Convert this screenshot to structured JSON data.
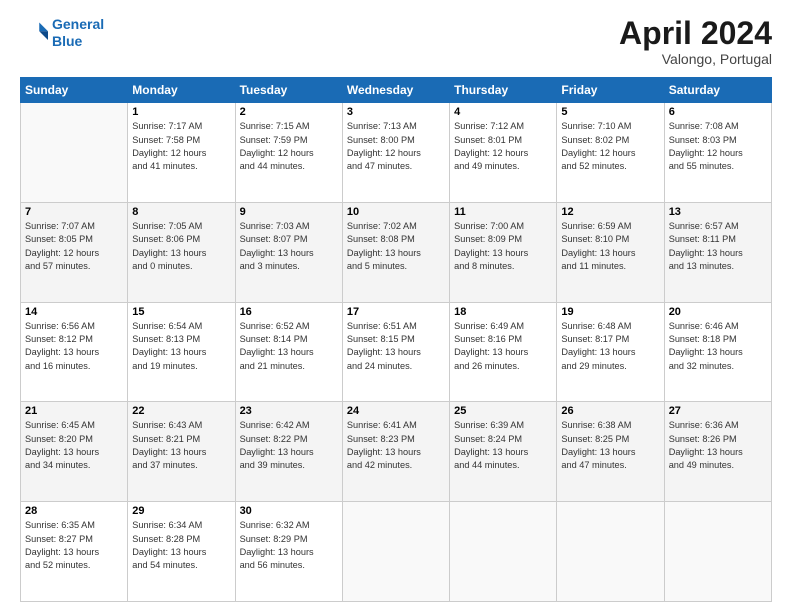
{
  "header": {
    "logo_line1": "General",
    "logo_line2": "Blue",
    "month_title": "April 2024",
    "location": "Valongo, Portugal"
  },
  "days_of_week": [
    "Sunday",
    "Monday",
    "Tuesday",
    "Wednesday",
    "Thursday",
    "Friday",
    "Saturday"
  ],
  "weeks": [
    [
      {
        "day": "",
        "info": ""
      },
      {
        "day": "1",
        "info": "Sunrise: 7:17 AM\nSunset: 7:58 PM\nDaylight: 12 hours\nand 41 minutes."
      },
      {
        "day": "2",
        "info": "Sunrise: 7:15 AM\nSunset: 7:59 PM\nDaylight: 12 hours\nand 44 minutes."
      },
      {
        "day": "3",
        "info": "Sunrise: 7:13 AM\nSunset: 8:00 PM\nDaylight: 12 hours\nand 47 minutes."
      },
      {
        "day": "4",
        "info": "Sunrise: 7:12 AM\nSunset: 8:01 PM\nDaylight: 12 hours\nand 49 minutes."
      },
      {
        "day": "5",
        "info": "Sunrise: 7:10 AM\nSunset: 8:02 PM\nDaylight: 12 hours\nand 52 minutes."
      },
      {
        "day": "6",
        "info": "Sunrise: 7:08 AM\nSunset: 8:03 PM\nDaylight: 12 hours\nand 55 minutes."
      }
    ],
    [
      {
        "day": "7",
        "info": "Sunrise: 7:07 AM\nSunset: 8:05 PM\nDaylight: 12 hours\nand 57 minutes."
      },
      {
        "day": "8",
        "info": "Sunrise: 7:05 AM\nSunset: 8:06 PM\nDaylight: 13 hours\nand 0 minutes."
      },
      {
        "day": "9",
        "info": "Sunrise: 7:03 AM\nSunset: 8:07 PM\nDaylight: 13 hours\nand 3 minutes."
      },
      {
        "day": "10",
        "info": "Sunrise: 7:02 AM\nSunset: 8:08 PM\nDaylight: 13 hours\nand 5 minutes."
      },
      {
        "day": "11",
        "info": "Sunrise: 7:00 AM\nSunset: 8:09 PM\nDaylight: 13 hours\nand 8 minutes."
      },
      {
        "day": "12",
        "info": "Sunrise: 6:59 AM\nSunset: 8:10 PM\nDaylight: 13 hours\nand 11 minutes."
      },
      {
        "day": "13",
        "info": "Sunrise: 6:57 AM\nSunset: 8:11 PM\nDaylight: 13 hours\nand 13 minutes."
      }
    ],
    [
      {
        "day": "14",
        "info": "Sunrise: 6:56 AM\nSunset: 8:12 PM\nDaylight: 13 hours\nand 16 minutes."
      },
      {
        "day": "15",
        "info": "Sunrise: 6:54 AM\nSunset: 8:13 PM\nDaylight: 13 hours\nand 19 minutes."
      },
      {
        "day": "16",
        "info": "Sunrise: 6:52 AM\nSunset: 8:14 PM\nDaylight: 13 hours\nand 21 minutes."
      },
      {
        "day": "17",
        "info": "Sunrise: 6:51 AM\nSunset: 8:15 PM\nDaylight: 13 hours\nand 24 minutes."
      },
      {
        "day": "18",
        "info": "Sunrise: 6:49 AM\nSunset: 8:16 PM\nDaylight: 13 hours\nand 26 minutes."
      },
      {
        "day": "19",
        "info": "Sunrise: 6:48 AM\nSunset: 8:17 PM\nDaylight: 13 hours\nand 29 minutes."
      },
      {
        "day": "20",
        "info": "Sunrise: 6:46 AM\nSunset: 8:18 PM\nDaylight: 13 hours\nand 32 minutes."
      }
    ],
    [
      {
        "day": "21",
        "info": "Sunrise: 6:45 AM\nSunset: 8:20 PM\nDaylight: 13 hours\nand 34 minutes."
      },
      {
        "day": "22",
        "info": "Sunrise: 6:43 AM\nSunset: 8:21 PM\nDaylight: 13 hours\nand 37 minutes."
      },
      {
        "day": "23",
        "info": "Sunrise: 6:42 AM\nSunset: 8:22 PM\nDaylight: 13 hours\nand 39 minutes."
      },
      {
        "day": "24",
        "info": "Sunrise: 6:41 AM\nSunset: 8:23 PM\nDaylight: 13 hours\nand 42 minutes."
      },
      {
        "day": "25",
        "info": "Sunrise: 6:39 AM\nSunset: 8:24 PM\nDaylight: 13 hours\nand 44 minutes."
      },
      {
        "day": "26",
        "info": "Sunrise: 6:38 AM\nSunset: 8:25 PM\nDaylight: 13 hours\nand 47 minutes."
      },
      {
        "day": "27",
        "info": "Sunrise: 6:36 AM\nSunset: 8:26 PM\nDaylight: 13 hours\nand 49 minutes."
      }
    ],
    [
      {
        "day": "28",
        "info": "Sunrise: 6:35 AM\nSunset: 8:27 PM\nDaylight: 13 hours\nand 52 minutes."
      },
      {
        "day": "29",
        "info": "Sunrise: 6:34 AM\nSunset: 8:28 PM\nDaylight: 13 hours\nand 54 minutes."
      },
      {
        "day": "30",
        "info": "Sunrise: 6:32 AM\nSunset: 8:29 PM\nDaylight: 13 hours\nand 56 minutes."
      },
      {
        "day": "",
        "info": ""
      },
      {
        "day": "",
        "info": ""
      },
      {
        "day": "",
        "info": ""
      },
      {
        "day": "",
        "info": ""
      }
    ]
  ]
}
